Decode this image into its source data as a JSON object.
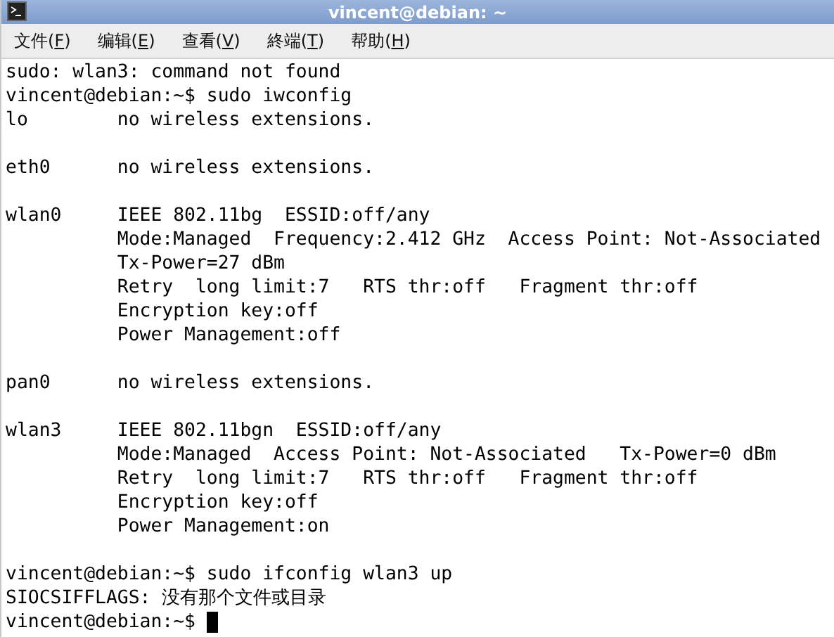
{
  "window": {
    "title": "vincent@debian: ~"
  },
  "menu": [
    {
      "before": "文件(",
      "key": "F",
      "after": ")"
    },
    {
      "before": "编辑(",
      "key": "E",
      "after": ")"
    },
    {
      "before": "查看(",
      "key": "V",
      "after": ")"
    },
    {
      "before": "終端(",
      "key": "T",
      "after": ")"
    },
    {
      "before": "帮助(",
      "key": "H",
      "after": ")"
    }
  ],
  "terminal": {
    "blocks": [
      {
        "lines": [
          "sudo: wlan3: command not found",
          "vincent@debian:~$ sudo iwconfig",
          "lo        no wireless extensions."
        ]
      },
      {
        "lines": [
          "eth0      no wireless extensions."
        ]
      },
      {
        "lines": [
          "wlan0     IEEE 802.11bg  ESSID:off/any",
          "          Mode:Managed  Frequency:2.412 GHz  Access Point: Not-Associated",
          "          Tx-Power=27 dBm",
          "          Retry  long limit:7   RTS thr:off   Fragment thr:off",
          "          Encryption key:off",
          "          Power Management:off"
        ]
      },
      {
        "lines": [
          "pan0      no wireless extensions."
        ]
      },
      {
        "lines": [
          "wlan3     IEEE 802.11bgn  ESSID:off/any",
          "          Mode:Managed  Access Point: Not-Associated   Tx-Power=0 dBm",
          "          Retry  long limit:7   RTS thr:off   Fragment thr:off",
          "          Encryption key:off",
          "          Power Management:on"
        ]
      },
      {
        "lines": [
          "vincent@debian:~$ sudo ifconfig wlan3 up",
          "SIOCSIFFLAGS: 没有那个文件或目录",
          "vincent@debian:~$ "
        ]
      }
    ],
    "cursor": true
  }
}
